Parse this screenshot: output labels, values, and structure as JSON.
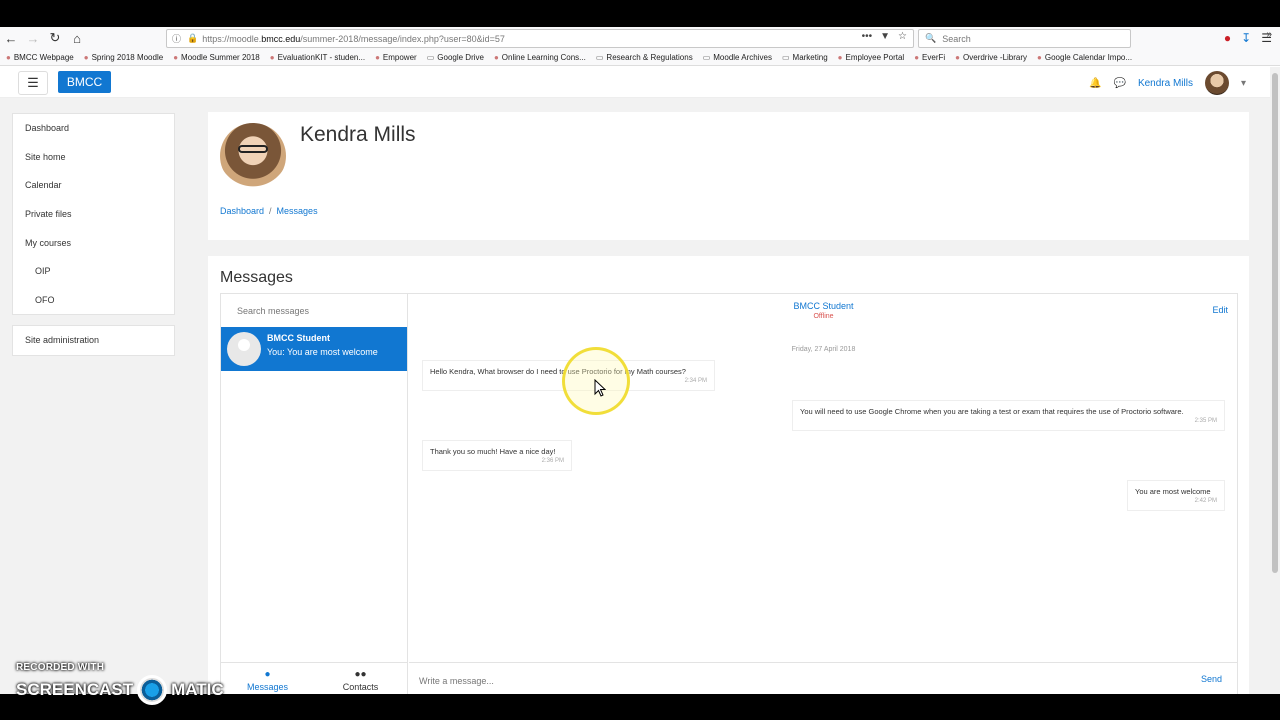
{
  "browser": {
    "url_prefix": "https://moodle.",
    "url_domain": "bmcc.edu",
    "url_path": "/summer-2018/message/index.php?user=80&id=57",
    "search_placeholder": "Search",
    "bookmarks": [
      {
        "label": "BMCC Webpage",
        "icon": "bmcc-icon"
      },
      {
        "label": "Spring 2018 Moodle",
        "icon": "moodle-icon"
      },
      {
        "label": "Moodle Summer 2018",
        "icon": "moodle-icon"
      },
      {
        "label": "EvaluationKIT - studen...",
        "icon": "evalkit-icon"
      },
      {
        "label": "Empower",
        "icon": "empower-icon"
      },
      {
        "label": "Google Drive",
        "icon": "folder-icon"
      },
      {
        "label": "Online Learning Cons...",
        "icon": "olc-icon"
      },
      {
        "label": "Research & Regulations",
        "icon": "folder-icon"
      },
      {
        "label": "Moodle Archives",
        "icon": "folder-icon"
      },
      {
        "label": "Marketing",
        "icon": "folder-icon"
      },
      {
        "label": "Employee Portal",
        "icon": "portal-icon"
      },
      {
        "label": "EverFi",
        "icon": "everfi-icon"
      },
      {
        "label": "Overdrive -Library",
        "icon": "overdrive-icon"
      },
      {
        "label": "Google Calendar Impo...",
        "icon": "calendar-icon"
      }
    ]
  },
  "navbar": {
    "brand": "BMCC",
    "user_name": "Kendra Mills"
  },
  "sidebar": {
    "main_items": [
      "Dashboard",
      "Site home",
      "Calendar",
      "Private files",
      "My courses"
    ],
    "course_items": [
      "OIP",
      "OFO"
    ],
    "admin_item": "Site administration"
  },
  "header": {
    "name": "Kendra Mills",
    "breadcrumb": [
      "Dashboard",
      "Messages"
    ]
  },
  "messages": {
    "title": "Messages",
    "search_placeholder": "Search messages",
    "contact": {
      "name": "BMCC Student",
      "preview": "You: You are most welcome"
    },
    "tabs": {
      "messages": "Messages",
      "contacts": "Contacts"
    },
    "conversation": {
      "name": "BMCC Student",
      "status": "Offline",
      "edit": "Edit",
      "date": "Friday, 27 April 2018",
      "items": [
        {
          "text": "Hello Kendra, What browser do I need to use Proctorio for my Math courses?",
          "time": "2:34 PM",
          "side": "left"
        },
        {
          "text": "You will need to use Google Chrome when you are taking a test or exam that requires the use of Proctorio software.",
          "time": "2:35 PM",
          "side": "right"
        },
        {
          "text": "Thank you so much! Have a nice day!",
          "time": "2:36 PM",
          "side": "left"
        },
        {
          "text": "You are most welcome",
          "time": "2:42 PM",
          "side": "right"
        }
      ]
    },
    "composer_placeholder": "Write a message...",
    "send": "Send"
  },
  "watermark": {
    "line1": "RECORDED WITH",
    "line2a": "SCREENCAST",
    "line2b": "MATIC"
  },
  "colors": {
    "accent": "#1177d1",
    "status_offline": "#d9534f"
  }
}
